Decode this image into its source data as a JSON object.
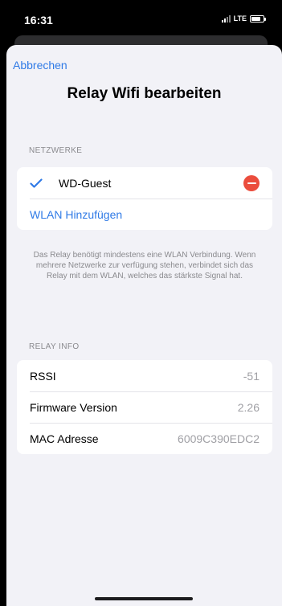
{
  "status_bar": {
    "time": "16:31",
    "network": "LTE",
    "battery_level": 0.8
  },
  "header": {
    "cancel_label": "Abbrechen",
    "title": "Relay Wifi bearbeiten"
  },
  "networks_section": {
    "header": "NETZWERKE",
    "networks": [
      {
        "name": "WD-Guest",
        "selected": true
      }
    ],
    "add_label": "WLAN Hinzufügen",
    "footnote": "Das Relay benötigt mindestens eine WLAN Verbindung. Wenn mehrere Netzwerke zur verfügung stehen, verbindet sich das Relay mit dem WLAN, welches das stärkste Signal hat."
  },
  "relay_info_section": {
    "header": "RELAY INFO",
    "rows": [
      {
        "label": "RSSI",
        "value": "-51"
      },
      {
        "label": "Firmware Version",
        "value": "2.26"
      },
      {
        "label": "MAC Adresse",
        "value": "6009C390EDC2"
      }
    ]
  },
  "colors": {
    "accent": "#2f7ae6",
    "destructive": "#eb4d3d",
    "background": "#f2f2f7"
  },
  "icons": [
    "checkmark-icon",
    "delete-icon",
    "signal-icon",
    "battery-icon"
  ]
}
